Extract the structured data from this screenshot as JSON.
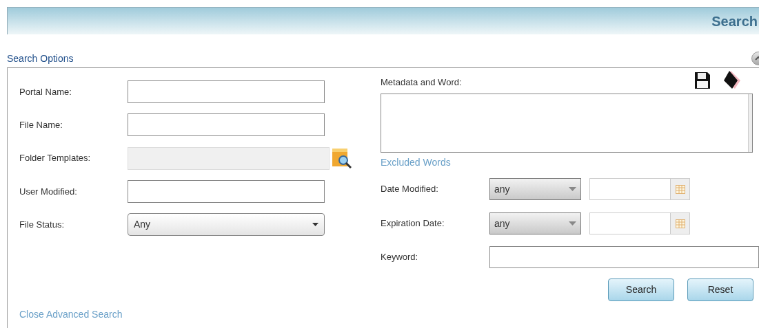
{
  "header": {
    "title": "Search"
  },
  "section": {
    "title": "Search Options",
    "expanded": true
  },
  "left_fields": [
    {
      "label": "Portal Name:",
      "kind": "text",
      "disabled": false
    },
    {
      "label": "File Name:",
      "kind": "text",
      "disabled": false
    },
    {
      "label": "Folder Templates:",
      "kind": "lookup",
      "disabled": true
    },
    {
      "label": "User Modified:",
      "kind": "text",
      "disabled": false
    },
    {
      "label": "File Status:",
      "kind": "dropdown",
      "value": "Any"
    }
  ],
  "close_link": "Close Advanced Search",
  "metadata": {
    "label": "Metadata and Word:"
  },
  "excluded_link": "Excluded Words",
  "date_filters": [
    {
      "label": "Date Modified:",
      "value": "any"
    },
    {
      "label": "Expiration Date:",
      "value": "any"
    }
  ],
  "keyword": {
    "label": "Keyword:"
  },
  "buttons": [
    "Search",
    "Reset"
  ]
}
